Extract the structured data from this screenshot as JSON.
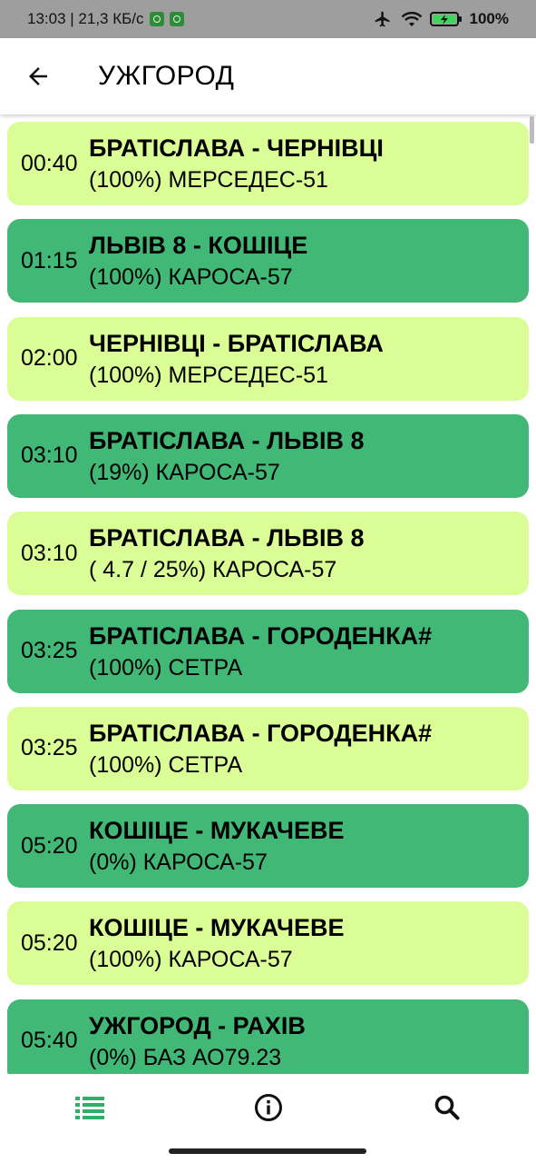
{
  "status_bar": {
    "time_speed": "13:03 | 21,3 КБ/с",
    "battery": "100%"
  },
  "header": {
    "title": "УЖГОРОД",
    "back_icon": "arrow-left-icon"
  },
  "trips": [
    {
      "time": "00:40",
      "route": "БРАТІСЛАВА - ЧЕРНІВЦІ",
      "bus": "(100%) МЕРСЕДЕС-51",
      "style": "light"
    },
    {
      "time": "01:15",
      "route": "ЛЬВІВ 8 - КОШІЦЕ",
      "bus": "(100%) КАРОСА-57",
      "style": "dark"
    },
    {
      "time": "02:00",
      "route": "ЧЕРНІВЦІ - БРАТІСЛАВА",
      "bus": "(100%) МЕРСЕДЕС-51",
      "style": "light"
    },
    {
      "time": "03:10",
      "route": "БРАТІСЛАВА - ЛЬВІВ 8",
      "bus": "(19%) КАРОСА-57",
      "style": "dark"
    },
    {
      "time": "03:10",
      "route": "БРАТІСЛАВА - ЛЬВІВ 8",
      "bus": "( 4.7 / 25%) КАРОСА-57",
      "style": "light"
    },
    {
      "time": "03:25",
      "route": "БРАТІСЛАВА - ГОРОДЕНКА#",
      "bus": "(100%) СЕТРА",
      "style": "dark"
    },
    {
      "time": "03:25",
      "route": "БРАТІСЛАВА - ГОРОДЕНКА#",
      "bus": "(100%) СЕТРА",
      "style": "light"
    },
    {
      "time": "05:20",
      "route": "КОШІЦЕ - МУКАЧЕВЕ",
      "bus": "(0%) КАРОСА-57",
      "style": "dark"
    },
    {
      "time": "05:20",
      "route": "КОШІЦЕ - МУКАЧЕВЕ",
      "bus": "(100%) КАРОСА-57",
      "style": "light"
    },
    {
      "time": "05:40",
      "route": "УЖГОРОД - РАХІВ",
      "bus": "(0%) БАЗ АО79.23",
      "style": "dark"
    }
  ],
  "bottom_nav": [
    {
      "icon": "list-icon",
      "active": true
    },
    {
      "icon": "info-icon",
      "active": false
    },
    {
      "icon": "search-icon",
      "active": false
    }
  ],
  "colors": {
    "card_light": "#dbfd96",
    "card_dark": "#41b875",
    "nav_active": "#2fb06a"
  }
}
